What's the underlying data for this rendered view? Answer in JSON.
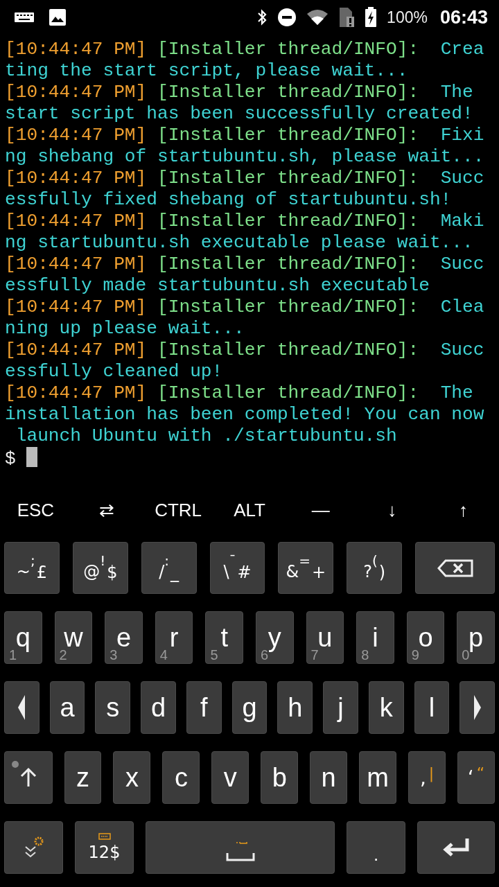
{
  "status_bar": {
    "battery": "100%",
    "time": "06:43"
  },
  "terminal": {
    "log": [
      {
        "time": "[10:44:47 PM]",
        "source": "[Installer thread/INFO]:",
        "message": "Creating the start script, please wait..."
      },
      {
        "time": "[10:44:47 PM]",
        "source": "[Installer thread/INFO]:",
        "message": "The start script has been successfully created!"
      },
      {
        "time": "[10:44:47 PM]",
        "source": "[Installer thread/INFO]:",
        "message": "Fixing shebang of startubuntu.sh, please wait..."
      },
      {
        "time": "[10:44:47 PM]",
        "source": "[Installer thread/INFO]:",
        "message": "Successfully fixed shebang of startubuntu.sh!"
      },
      {
        "time": "[10:44:47 PM]",
        "source": "[Installer thread/INFO]:",
        "message": "Making startubuntu.sh executable please wait..."
      },
      {
        "time": "[10:44:47 PM]",
        "source": "[Installer thread/INFO]:",
        "message": "Successfully made startubuntu.sh executable"
      },
      {
        "time": "[10:44:47 PM]",
        "source": "[Installer thread/INFO]:",
        "message": "Cleaning up please wait..."
      },
      {
        "time": "[10:44:47 PM]",
        "source": "[Installer thread/INFO]:",
        "message": "Successfully cleaned up!"
      },
      {
        "time": "[10:44:47 PM]",
        "source": "[Installer thread/INFO]:",
        "message": "The installation has been completed! You can now launch Ubuntu with ./startubuntu.sh"
      }
    ],
    "prompt": "$",
    "cursor": true
  },
  "extra_keys": [
    "ESC",
    "⇄",
    "CTRL",
    "ALT",
    "—",
    "↓",
    "↑"
  ],
  "keyboard": {
    "symbol_keys": [
      {
        "kind": "symbol",
        "main": "~",
        "top": ";",
        "right": "£"
      },
      {
        "kind": "symbol",
        "main": "@",
        "top": "!",
        "right": "$"
      },
      {
        "kind": "symbol",
        "main": "/",
        "top": ":",
        "right": "_"
      },
      {
        "kind": "symbol",
        "main": "\\",
        "top": "¯",
        "right": "#"
      },
      {
        "kind": "symbol",
        "main": "&",
        "top": "=",
        "right": "+"
      },
      {
        "kind": "symbol",
        "main": "?",
        "top": "(",
        "right": ")"
      },
      {
        "kind": "backspace"
      }
    ],
    "upper_keys": [
      {
        "kind": "letter",
        "label": "q",
        "hint": "1"
      },
      {
        "kind": "letter",
        "label": "w",
        "hint": "2"
      },
      {
        "kind": "letter",
        "label": "e",
        "hint": "3"
      },
      {
        "kind": "letter",
        "label": "r",
        "hint": "4"
      },
      {
        "kind": "letter",
        "label": "t",
        "hint": "5"
      },
      {
        "kind": "letter",
        "label": "y",
        "hint": "6"
      },
      {
        "kind": "letter",
        "label": "u",
        "hint": "7"
      },
      {
        "kind": "letter",
        "label": "i",
        "hint": "8"
      },
      {
        "kind": "letter",
        "label": "o",
        "hint": "9"
      },
      {
        "kind": "letter",
        "label": "p",
        "hint": "0"
      }
    ],
    "middle_keys": [
      {
        "kind": "arrow_left"
      },
      {
        "kind": "letter",
        "label": "a"
      },
      {
        "kind": "letter",
        "label": "s"
      },
      {
        "kind": "letter",
        "label": "d"
      },
      {
        "kind": "letter",
        "label": "f"
      },
      {
        "kind": "letter",
        "label": "g"
      },
      {
        "kind": "letter",
        "label": "h"
      },
      {
        "kind": "letter",
        "label": "j"
      },
      {
        "kind": "letter",
        "label": "k"
      },
      {
        "kind": "letter",
        "label": "l"
      },
      {
        "kind": "arrow_right"
      }
    ],
    "lower_keys": [
      {
        "kind": "shift"
      },
      {
        "kind": "letter",
        "label": "z"
      },
      {
        "kind": "letter",
        "label": "x"
      },
      {
        "kind": "letter",
        "label": "c"
      },
      {
        "kind": "letter",
        "label": "v"
      },
      {
        "kind": "letter",
        "label": "b"
      },
      {
        "kind": "letter",
        "label": "n"
      },
      {
        "kind": "letter",
        "label": "m"
      },
      {
        "kind": "punct",
        "label": ",",
        "hint": "|"
      },
      {
        "kind": "punct",
        "label": "‘",
        "hint": "“"
      }
    ],
    "bottom_keys": [
      {
        "kind": "hide"
      },
      {
        "kind": "numbers",
        "label": "12$"
      },
      {
        "kind": "space"
      },
      {
        "kind": "period",
        "label": "."
      },
      {
        "kind": "enter"
      }
    ]
  }
}
